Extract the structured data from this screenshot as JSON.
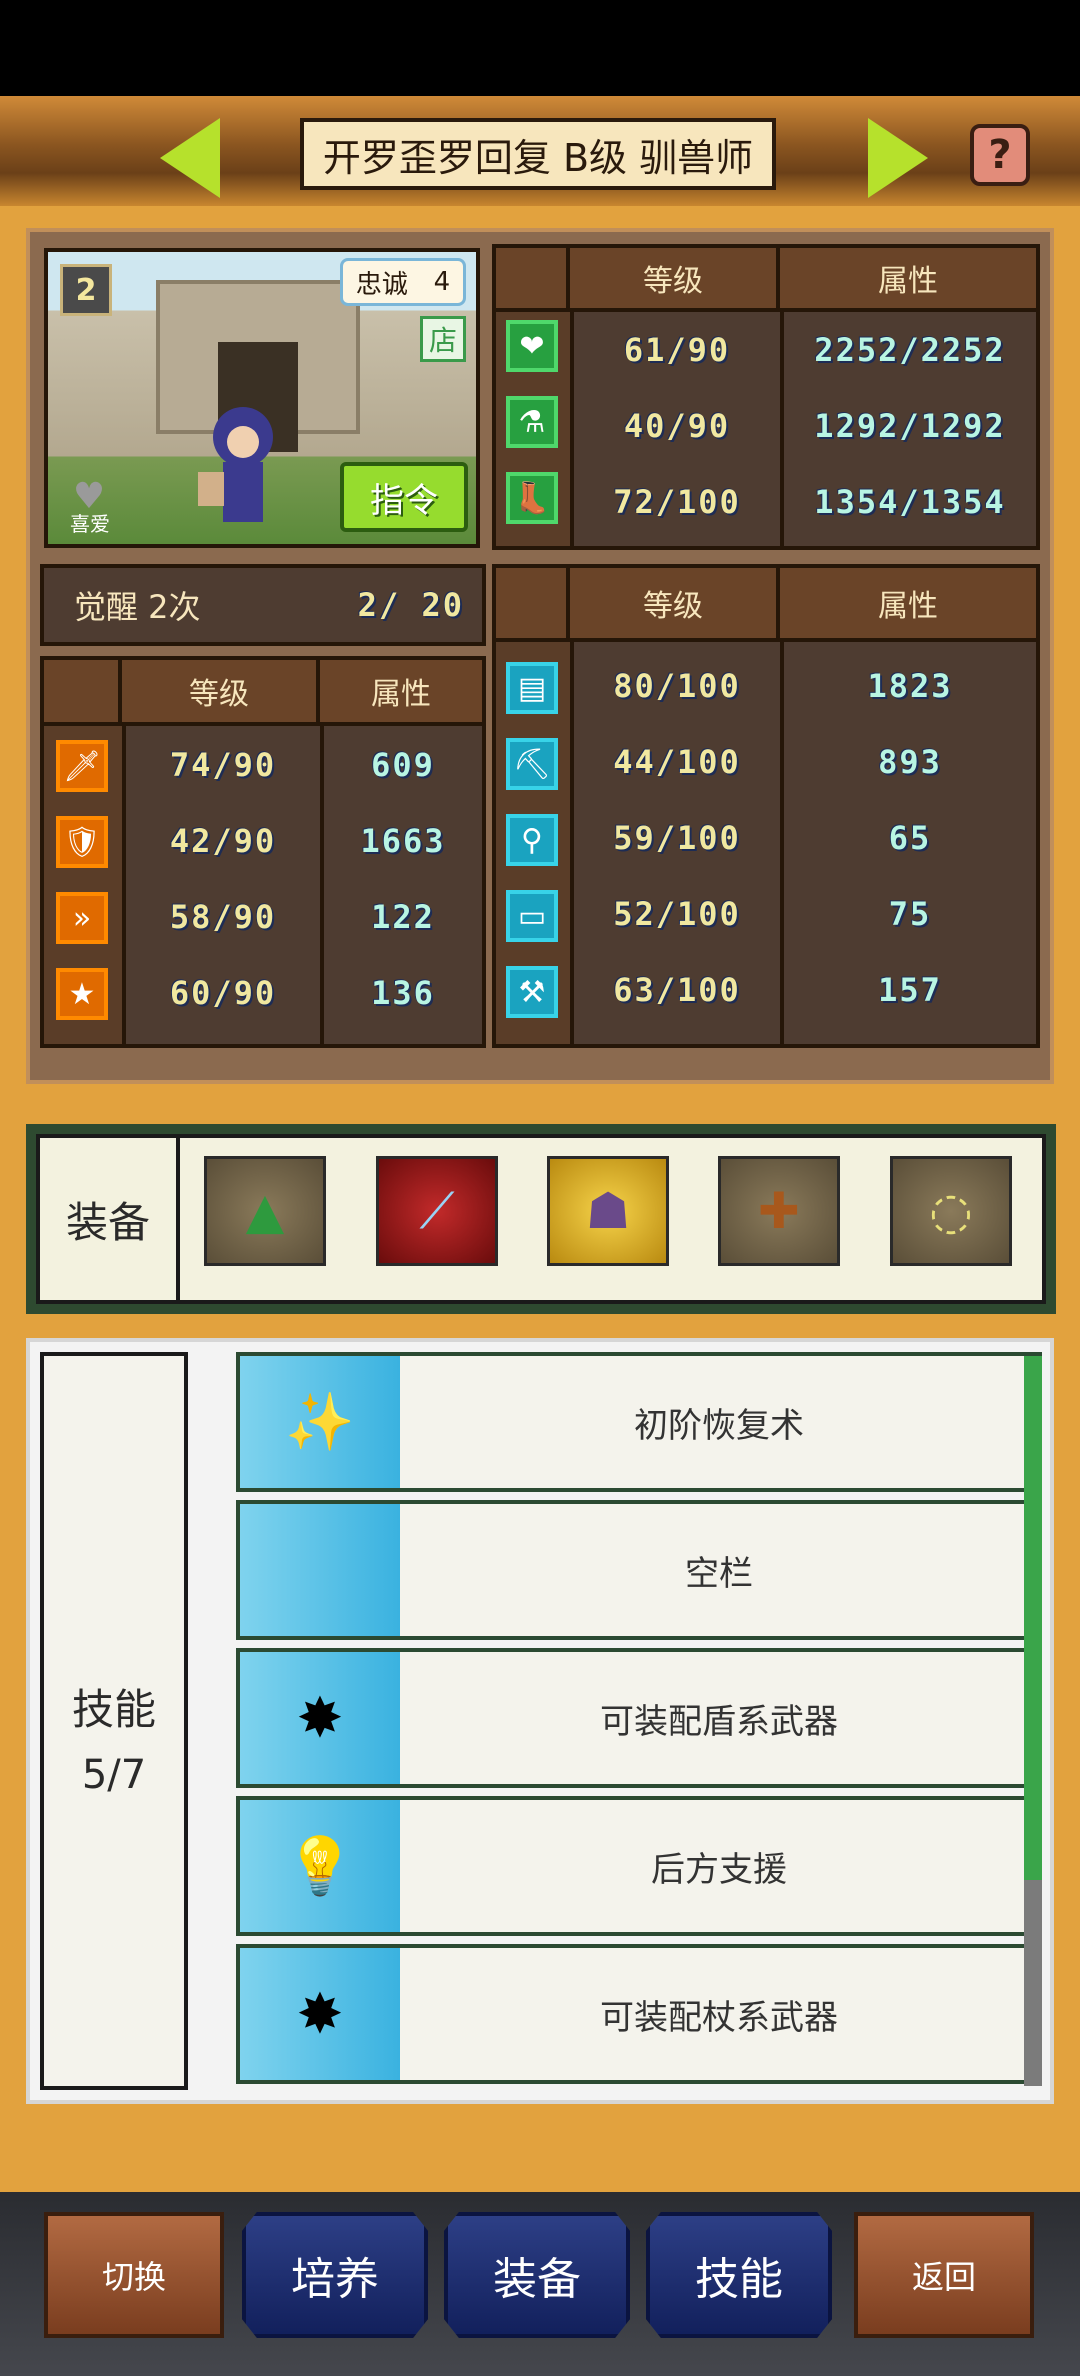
{
  "header": {
    "title": "开罗歪罗回复 B级 驯兽师"
  },
  "portrait": {
    "loyalty_label": "忠诚",
    "loyalty_value": "4",
    "shop_badge": "店",
    "level_badge": "2",
    "favorite_label": "喜爱",
    "command_label": "指令"
  },
  "awaken": {
    "label": "觉醒 2次",
    "progress": "2/ 20"
  },
  "top_stats": {
    "col_level": "等级",
    "col_attr": "属性",
    "rows": [
      {
        "icon": "heart-icon",
        "level": "61/90",
        "attr": "2252/2252"
      },
      {
        "icon": "potion-icon",
        "level": "40/90",
        "attr": "1292/1292"
      },
      {
        "icon": "boot-icon",
        "level": "72/100",
        "attr": "1354/1354"
      }
    ]
  },
  "left_stats": {
    "col_level": "等级",
    "col_attr": "属性",
    "rows": [
      {
        "icon": "sword-icon",
        "level": "74/90",
        "attr": "609"
      },
      {
        "icon": "shield-icon",
        "level": "42/90",
        "attr": "1663"
      },
      {
        "icon": "speed-icon",
        "level": "58/90",
        "attr": "122"
      },
      {
        "icon": "star-icon",
        "level": "60/90",
        "attr": "136"
      }
    ]
  },
  "right_stats": {
    "col_level": "等级",
    "col_attr": "属性",
    "rows": [
      {
        "icon": "book-icon",
        "level": "80/100",
        "attr": "1823"
      },
      {
        "icon": "pickaxe-icon",
        "level": "44/100",
        "attr": "893"
      },
      {
        "icon": "shovel-icon",
        "level": "59/100",
        "attr": "65"
      },
      {
        "icon": "chest-icon",
        "level": "52/100",
        "attr": "75"
      },
      {
        "icon": "tool-icon",
        "level": "63/100",
        "attr": "157"
      }
    ]
  },
  "equipment": {
    "label": "装备",
    "slots": [
      "wizard-hat-icon",
      "magic-staff-icon",
      "cat-doll-icon",
      "leather-armor-icon",
      "necklace-icon"
    ]
  },
  "skills": {
    "label": "技能",
    "count": "5/7",
    "items": [
      {
        "icon": "wand-icon",
        "name": "初阶恢复术"
      },
      {
        "icon": "",
        "name": "空栏"
      },
      {
        "icon": "sparkle-weapon-icon",
        "name": "可装配盾系武器"
      },
      {
        "icon": "lightbulb-icon",
        "name": "后方支援"
      },
      {
        "icon": "sparkle-weapon-icon",
        "name": "可装配杖系武器"
      }
    ]
  },
  "nav": {
    "switch": "切换",
    "train": "培养",
    "equip": "装备",
    "skill": "技能",
    "back": "返回"
  },
  "colors": {
    "background": "#e2a23e",
    "panel": "#8b6a4f",
    "accent": "#b6e12c"
  }
}
